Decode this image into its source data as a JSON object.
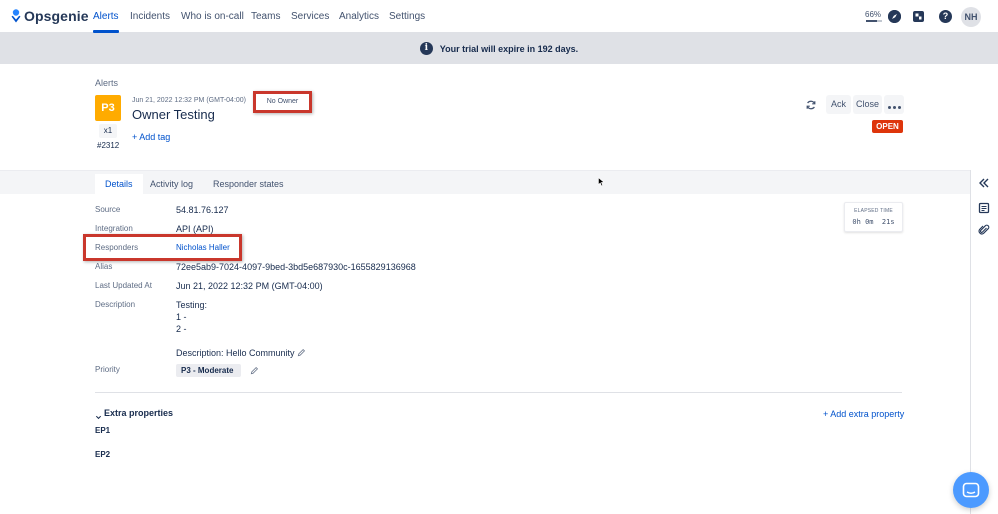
{
  "nav": {
    "logo_text": "Opsgenie",
    "items": [
      "Alerts",
      "Incidents",
      "Who is on-call",
      "Teams",
      "Services",
      "Analytics",
      "Settings"
    ],
    "active": "Alerts",
    "progress_label": "66%",
    "progress_value": 0.66,
    "avatar_initials": "NH"
  },
  "banner": {
    "info_glyph": "i",
    "text": "Your trial will expire in 192 days."
  },
  "alert": {
    "breadcrumb": "Alerts",
    "priority": "P3",
    "count": "x1",
    "tiny_id": "#2312",
    "date": "Jun 21, 2022 12:32 PM (GMT-04:00)",
    "owner": "No Owner",
    "title": "Owner Testing",
    "add_tag": "+ Add tag",
    "actions": {
      "ack": "Ack",
      "close": "Close"
    },
    "status": "OPEN"
  },
  "tabs": [
    "Details",
    "Activity log",
    "Responder states"
  ],
  "details": {
    "source_label": "Source",
    "source_value": "54.81.76.127",
    "integration_label": "Integration",
    "integration_value": "API (API)",
    "responders_label": "Responders",
    "responders_value": "Nicholas Haller",
    "alias_label": "Alias",
    "alias_value": "72ee5ab9-7024-4097-9bed-3bd5e687930c-1655829136968",
    "updated_label": "Last Updated At",
    "updated_value": "Jun 21, 2022 12:32 PM (GMT-04:00)",
    "description_label": "Description",
    "description_lines": [
      "Testing:",
      "1 -",
      "2 -"
    ],
    "description_extra": "Description: Hello Community",
    "priority_label": "Priority",
    "priority_value": "P3 - Moderate"
  },
  "elapsed": {
    "title": "ELAPSED TIME",
    "value": "0h 0m  21s"
  },
  "extra": {
    "heading": "Extra properties",
    "add": "+ Add extra property",
    "props": [
      "EP1",
      "EP2"
    ]
  },
  "colors": {
    "accent": "#0052cc",
    "priority": "#ffab00",
    "open": "#de350b",
    "highlight": "#c9372c"
  }
}
